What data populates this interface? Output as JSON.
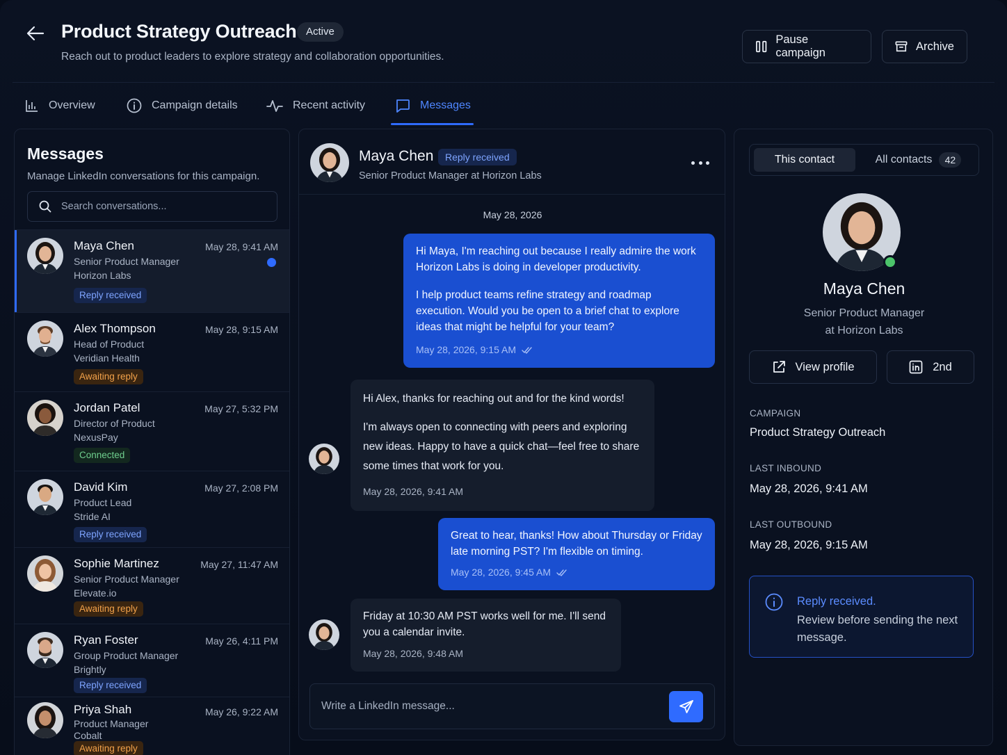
{
  "header": {
    "title": "Product Strategy Outreach",
    "status": "Active",
    "subtitle": "Reach out to product leaders to explore strategy and collaboration opportunities.",
    "pause_label": "Pause campaign",
    "archive_label": "Archive"
  },
  "tabs": [
    {
      "label": "Overview",
      "icon": "bar-chart-icon"
    },
    {
      "label": "Campaign details",
      "icon": "info-icon"
    },
    {
      "label": "Recent activity",
      "icon": "activity-icon"
    },
    {
      "label": "Messages",
      "icon": "message-icon",
      "active": true
    }
  ],
  "sidebar": {
    "title": "Messages",
    "subtitle": "Manage LinkedIn conversations for this campaign.",
    "search_placeholder": "Search conversations...",
    "conversations": [
      {
        "name": "Maya Chen",
        "time": "May 28, 9:41 AM",
        "role": "Senior Product Manager",
        "company": "Horizon Labs",
        "badge": "Reply received",
        "badge_type": "reply",
        "unread": true,
        "selected": true
      },
      {
        "name": "Alex Thompson",
        "time": "May 28, 9:15 AM",
        "role": "Head of Product",
        "company": "Veridian Health",
        "badge": "Awaiting reply",
        "badge_type": "await"
      },
      {
        "name": "Jordan Patel",
        "time": "May 27, 5:32 PM",
        "role": "Director of Product",
        "company": "NexusPay",
        "badge": "Connected",
        "badge_type": "connected"
      },
      {
        "name": "David Kim",
        "time": "May 27, 2:08 PM",
        "role": "Product Lead",
        "company": "Stride AI",
        "badge": "Reply received",
        "badge_type": "reply"
      },
      {
        "name": "Sophie Martinez",
        "time": "May 27, 11:47 AM",
        "role": "Senior Product Manager",
        "company": "Elevate.io",
        "badge": "Awaiting reply",
        "badge_type": "await"
      },
      {
        "name": "Ryan Foster",
        "time": "May 26, 4:11 PM",
        "role": "Group Product Manager",
        "company": "Brightly",
        "badge": "Reply received",
        "badge_type": "reply"
      },
      {
        "name": "Priya Shah",
        "time": "May 26, 9:22 AM",
        "role": "Product Manager",
        "company": "Cobalt",
        "badge": "Awaiting reply",
        "badge_type": "await"
      }
    ]
  },
  "chat": {
    "name": "Maya Chen",
    "badge": "Reply received",
    "role": "Senior Product Manager at Horizon Labs",
    "date_separator": "May 28, 2026",
    "messages": [
      {
        "dir": "out",
        "paragraphs": [
          "Hi Maya, I'm reaching out because I really admire the work Horizon Labs is doing in developer productivity.",
          "I help product teams refine strategy and roadmap execution. Would you be open to a brief chat to explore ideas that might be helpful for your team?"
        ],
        "time": "May 28, 2026, 9:15 AM"
      },
      {
        "dir": "in",
        "paragraphs": [
          "Hi Alex, thanks for reaching out and for the kind words!",
          "I'm always open to connecting with peers and exploring new ideas. Happy to have a quick chat—feel free to share some times that work for you."
        ],
        "time": "May 28, 2026, 9:41 AM"
      },
      {
        "dir": "out",
        "paragraphs": [
          "Great to hear, thanks! How about Thursday or Friday late morning PST? I'm flexible on timing."
        ],
        "time": "May 28, 2026, 9:45 AM"
      },
      {
        "dir": "in",
        "paragraphs": [
          "Friday at 10:30 AM PST works well for me. I'll send you a calendar invite."
        ],
        "time": "May 28, 2026, 9:48 AM"
      }
    ],
    "composer_placeholder": "Write a LinkedIn message..."
  },
  "contact": {
    "seg_this": "This contact",
    "seg_all": "All contacts",
    "all_count": "42",
    "name": "Maya Chen",
    "role_line1": "Senior Product Manager",
    "role_line2": "at Horizon Labs",
    "view_profile": "View profile",
    "degree": "2nd",
    "campaign_label": "CAMPAIGN",
    "campaign_value": "Product Strategy Outreach",
    "last_inbound_label": "LAST INBOUND",
    "last_inbound_value": "May 28, 2026, 9:41 AM",
    "last_outbound_label": "LAST OUTBOUND",
    "last_outbound_value": "May 28, 2026, 9:15 AM",
    "note_title": "Reply received.",
    "note_text": "Review before sending the next message."
  },
  "colors": {
    "accent": "#2f6bff",
    "background": "#070d1a",
    "reply_badge": "#7ea4ff",
    "await_badge": "#f3a24a",
    "connected_badge": "#6fcf8e",
    "online": "#4cc46a"
  }
}
